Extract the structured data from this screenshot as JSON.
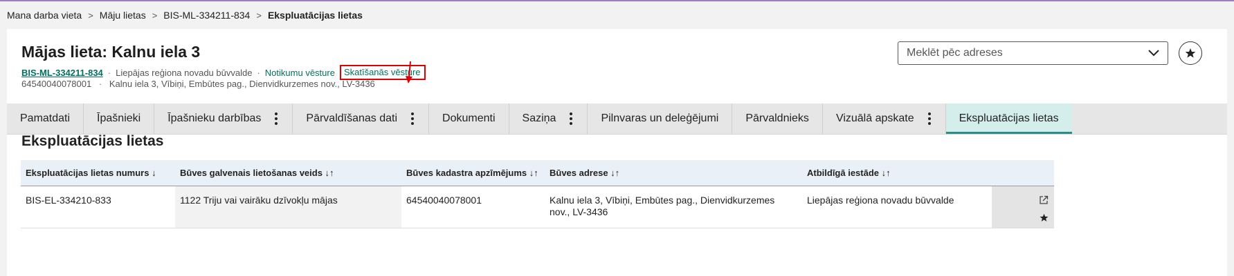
{
  "breadcrumb": [
    {
      "label": "Mana darba vieta"
    },
    {
      "label": "Māju lietas"
    },
    {
      "label": "BIS-ML-334211-834"
    },
    {
      "label": "Ekspluatācijas lietas"
    }
  ],
  "header": {
    "title": "Mājas lieta: Kalnu iela 3",
    "case_number": "BIS-ML-334211-834",
    "authority": "Liepājas reģiona novadu būvvalde",
    "event_history": "Notikumu vēsture",
    "view_history": "Skatīšanās vēsture",
    "cadastre": "64540040078001",
    "address": "Kalnu iela 3, Vībiņi, Embūtes pag., Dienvidkurzemes nov., LV-3436"
  },
  "search": {
    "placeholder": "Meklēt pēc adreses"
  },
  "tabs": [
    {
      "label": "Pamatdati",
      "menu": false,
      "active": false
    },
    {
      "label": "Īpašnieki",
      "menu": false,
      "active": false
    },
    {
      "label": "Īpašnieku darbības",
      "menu": true,
      "active": false
    },
    {
      "label": "Pārvaldīšanas dati",
      "menu": true,
      "active": false
    },
    {
      "label": "Dokumenti",
      "menu": false,
      "active": false
    },
    {
      "label": "Saziņa",
      "menu": true,
      "active": false
    },
    {
      "label": "Pilnvaras un deleģējumi",
      "menu": false,
      "active": false
    },
    {
      "label": "Pārvaldnieks",
      "menu": false,
      "active": false
    },
    {
      "label": "Vizuālā apskate",
      "menu": true,
      "active": false
    },
    {
      "label": "Ekspluatācijas lietas",
      "menu": false,
      "active": true
    }
  ],
  "section": {
    "title": "Ekspluatācijas lietas"
  },
  "table": {
    "headers": [
      "Ekspluatācijas lietas numurs ↓",
      "Būves galvenais lietošanas veids ↓↑",
      "Būves kadastra apzīmējums ↓↑",
      "Būves adrese ↓↑",
      "Atbildīgā iestāde ↓↑"
    ],
    "rows": [
      [
        "BIS-EL-334210-833",
        "1122 Triju vai vairāku dzīvokļu mājas",
        "64540040078001",
        "Kalnu iela 3, Vībiņi, Embūtes pag., Dienvidkurzemes nov., LV-3436",
        "Liepājas reģiona novadu būvvalde"
      ]
    ]
  },
  "colors": {
    "accent": "#00705d",
    "active_tab_bg": "#d3eeeb",
    "annotation": "#e00000"
  }
}
